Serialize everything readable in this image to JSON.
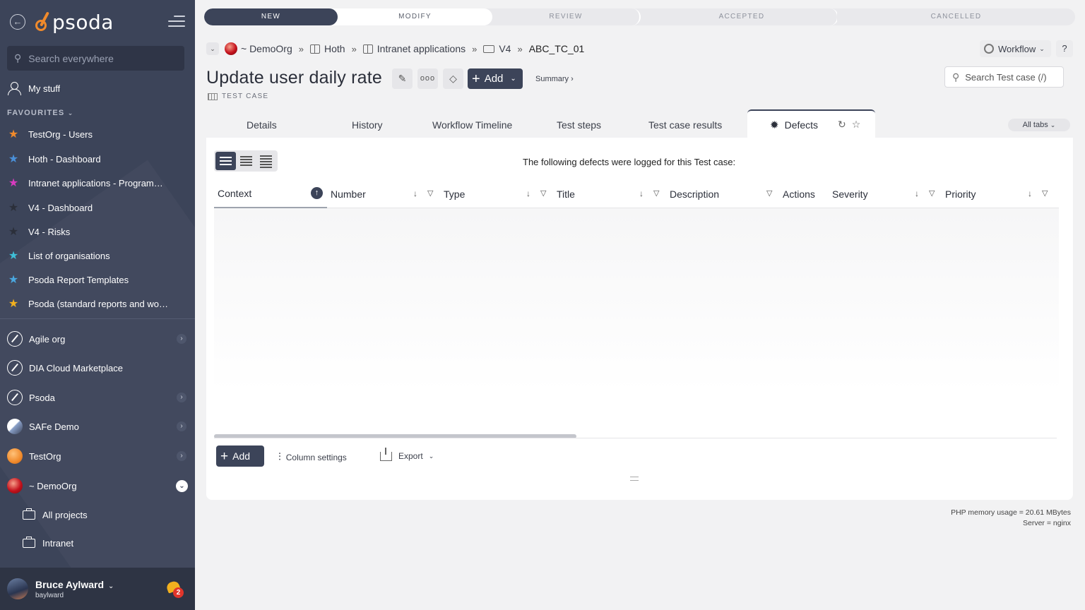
{
  "sidebar": {
    "logo": "psoda",
    "search_placeholder": "Search everywhere",
    "my_stuff": "My stuff",
    "favourites_heading": "FAVOURITES",
    "favourites": [
      {
        "label": "TestOrg - Users",
        "color": "#f08a2b"
      },
      {
        "label": "Hoth - Dashboard",
        "color": "#4a90d9"
      },
      {
        "label": "Intranet applications - Programme...",
        "color": "#d83bbf"
      },
      {
        "label": "V4 - Dashboard",
        "color": "#2b2f3a"
      },
      {
        "label": "V4 - Risks",
        "color": "#2b2f3a"
      },
      {
        "label": "List of organisations",
        "color": "#3ec0d8"
      },
      {
        "label": "Psoda Report Templates",
        "color": "#4aa8e0"
      },
      {
        "label": "Psoda (standard reports and work...",
        "color": "#f2b01e"
      }
    ],
    "orgs": [
      {
        "label": "Agile org",
        "expand": "closed"
      },
      {
        "label": "DIA Cloud Marketplace",
        "expand": "none"
      },
      {
        "label": "Psoda",
        "expand": "closed"
      },
      {
        "label": "SAFe Demo",
        "expand": "closed"
      },
      {
        "label": "TestOrg",
        "expand": "closed"
      },
      {
        "label": "~ DemoOrg",
        "expand": "open"
      }
    ],
    "projects": [
      {
        "label": "All projects"
      },
      {
        "label": "Intranet"
      }
    ],
    "user": {
      "name": "Bruce Aylward",
      "login": "baylward",
      "notifications": "2"
    }
  },
  "workflow_steps": [
    "NEW",
    "MODIFY",
    "REVIEW",
    "ACCEPTED",
    "CANCELLED"
  ],
  "breadcrumb": {
    "org": "~ DemoOrg",
    "items": [
      "Hoth",
      "Intranet applications",
      "V4"
    ],
    "current": "ABC_TC_01",
    "sep": "»"
  },
  "workflow_button": "Workflow",
  "help_button": "?",
  "title": "Update user daily rate",
  "item_type": "TEST CASE",
  "add_button": "Add",
  "summary_link": "Summary ›",
  "search_placeholder": "Search Test case (/)",
  "tabs": [
    "Details",
    "History",
    "Workflow Timeline",
    "Test steps",
    "Test case results"
  ],
  "active_tab": "Defects",
  "all_tabs": "All tabs",
  "panel": {
    "message": "The following defects were logged for this Test case:",
    "columns": [
      "Context",
      "Number",
      "Type",
      "Title",
      "Description",
      "Actions",
      "Severity",
      "Priority"
    ],
    "add_button": "Add",
    "column_settings": "Column settings",
    "export": "Export"
  },
  "footer": {
    "memory": "PHP memory usage = 20.61 MBytes",
    "server": "Server = nginx"
  }
}
